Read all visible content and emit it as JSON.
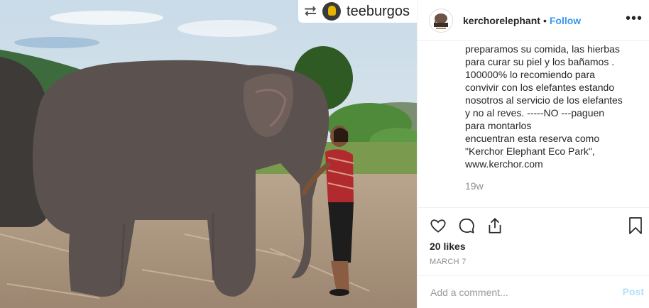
{
  "repost": {
    "icon": "repost-icon",
    "username": "teeburgos"
  },
  "header": {
    "avatar_icon": "kerchor-logo-icon",
    "username": "kerchorelephant",
    "separator": "•",
    "follow_label": "Follow",
    "more_icon": "more-options-icon",
    "more_glyph": "•••"
  },
  "caption": {
    "text": "preparamos su comida, las hierbas\npara curar su piel y los bañamos .\n100000% lo recomiendo para\nconvivir con los elefantes estando\nnosotros al servicio de los elefantes\ny no al reves. -----NO ---paguen\npara montarlos\nencuentran esta reserva como\n\"Kerchor Elephant Eco Park\",\nwww.kerchor.com",
    "age": "19w"
  },
  "actions": {
    "icons": [
      "heart-icon",
      "comment-icon",
      "share-icon",
      "bookmark-icon"
    ],
    "likes": "20 likes",
    "date": "MARCH 7"
  },
  "comment": {
    "placeholder": "Add a comment...",
    "post_label": "Post"
  },
  "colors": {
    "link": "#3897f0",
    "post_disabled": "#b2dffc",
    "muted": "#8e8e8e"
  }
}
